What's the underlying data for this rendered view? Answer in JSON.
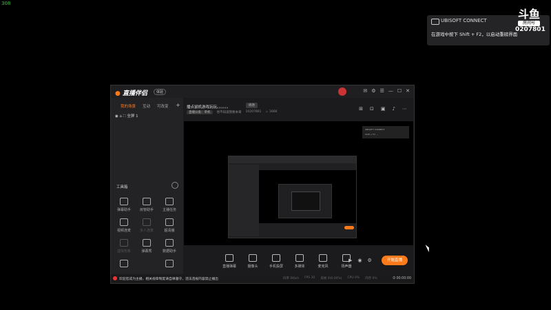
{
  "fps": "308",
  "notification": {
    "brand": "UBISOFT CONNECT",
    "message": "在游戏中按下 Shift + F2，以启动重磅界面"
  },
  "douyu": {
    "logo": "斗鱼",
    "room_label": "房间号",
    "room_id": "0207801"
  },
  "app": {
    "logo_text": "直播伴侣",
    "version_label": "体验",
    "left": {
      "tabs": [
        "我的场景",
        "互动",
        "可改变"
      ],
      "scene_item": "全屏 1",
      "tools_title": "工具箱",
      "tools": [
        {
          "label": "弹幕助手",
          "dim": false
        },
        {
          "label": "房管助手",
          "dim": false
        },
        {
          "label": "主播任务",
          "dim": false
        },
        {
          "label": "视频连麦",
          "dim": false
        },
        {
          "label": "多人连麦",
          "dim": true
        },
        {
          "label": "超清播",
          "dim": false
        },
        {
          "label": "虚拟形象",
          "dim": true
        },
        {
          "label": "弹幕秀",
          "dim": false
        },
        {
          "label": "数据助手",
          "dim": false
        },
        {
          "label": "PK",
          "dim": false
        },
        {
          "label": "",
          "dim": false
        },
        {
          "label": "",
          "dim": false
        }
      ]
    },
    "main": {
      "live_title": "播点鼠机游戏玩玩。。。。。。",
      "live_title_button": "修改",
      "meta": {
        "category": "直播分类：单机",
        "streamer": "他不知道我要本来",
        "room_id": "10207801",
        "hot": "1666"
      },
      "preview_inner": {
        "notif_line1": "UBISOFT CONNECT",
        "notif_line2": "Shift + F2 ..."
      },
      "controls": [
        "直播弹幕",
        "摄像头",
        "手机投屏",
        "多媒体",
        "麦克风",
        "扬声器"
      ],
      "start_button": "开始直播"
    },
    "statusbar": {
      "message": "欢迎您成为主播，相关规章制度请自律遵守，违法违规内容禁止播出",
      "stats": [
        "码率 0Kb/s",
        "FPS 30",
        "丢帧 0(0.00%)",
        "CPU 0%",
        "内存 0%"
      ],
      "time": "00:00:00"
    }
  }
}
